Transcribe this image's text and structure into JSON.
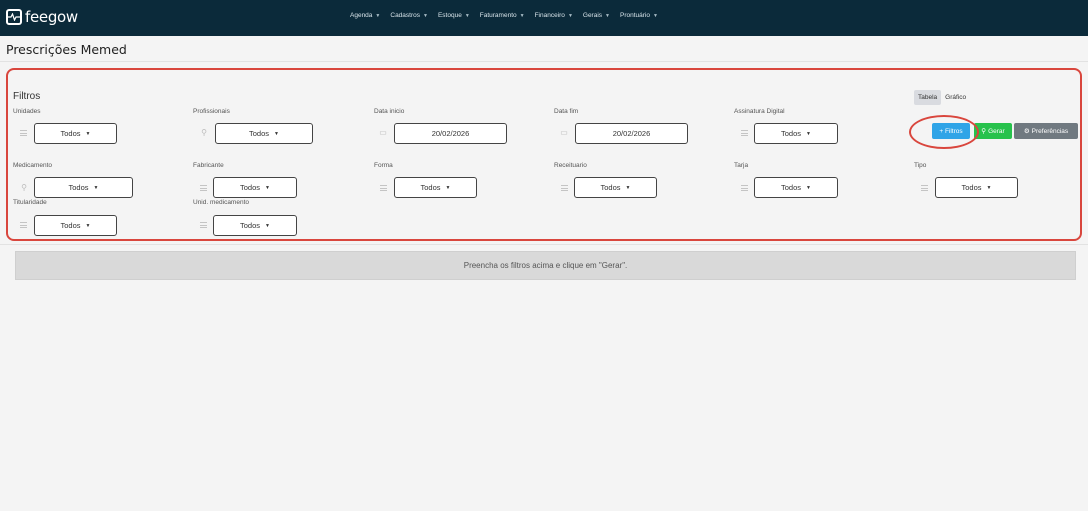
{
  "app": {
    "logo_text": "feegow"
  },
  "nav": {
    "items": [
      {
        "label": "Agenda"
      },
      {
        "label": "Cadastros"
      },
      {
        "label": "Estoque"
      },
      {
        "label": "Faturamento"
      },
      {
        "label": "Financeiro"
      },
      {
        "label": "Gerais"
      },
      {
        "label": "Prontuário"
      }
    ]
  },
  "page": {
    "title": "Prescrições Memed"
  },
  "filters": {
    "title": "Filtros",
    "unidades": {
      "label": "Unidades",
      "value": "Todos"
    },
    "profissionais": {
      "label": "Profissionais",
      "value": "Todos"
    },
    "data_inicio": {
      "label": "Data inicio",
      "value": "20/02/2026"
    },
    "data_fim": {
      "label": "Data fim",
      "value": "20/02/2026"
    },
    "assinatura": {
      "label": "Assinatura Digital",
      "value": "Todos"
    },
    "medicamento": {
      "label": "Medicamento",
      "value": "Todos"
    },
    "fabricante": {
      "label": "Fabricante",
      "value": "Todos"
    },
    "forma": {
      "label": "Forma",
      "value": "Todos"
    },
    "receituario": {
      "label": "Receituario",
      "value": "Todos"
    },
    "tarja": {
      "label": "Tarja",
      "value": "Todos"
    },
    "tipo": {
      "label": "Tipo",
      "value": "Todos"
    },
    "titularidade": {
      "label": "Titularidade",
      "value": "Todos"
    },
    "unid_medicamento": {
      "label": "Unid. medicamento",
      "value": "Todos"
    }
  },
  "view_toggle": {
    "table": "Tabela",
    "chart": "Gráfico",
    "active": "Tabela"
  },
  "actions": {
    "filtros": "+ Filtros",
    "gerar": "Gerar",
    "preferencias": "Preferências"
  },
  "info_message": "Preencha os filtros acima e clique em \"Gerar\".",
  "colors": {
    "topbar": "#0b2a3a",
    "highlight": "#d9463d",
    "filtros_button": "#2fa4e7",
    "gerar_button": "#27c24c",
    "preferencias_button": "#707980"
  }
}
